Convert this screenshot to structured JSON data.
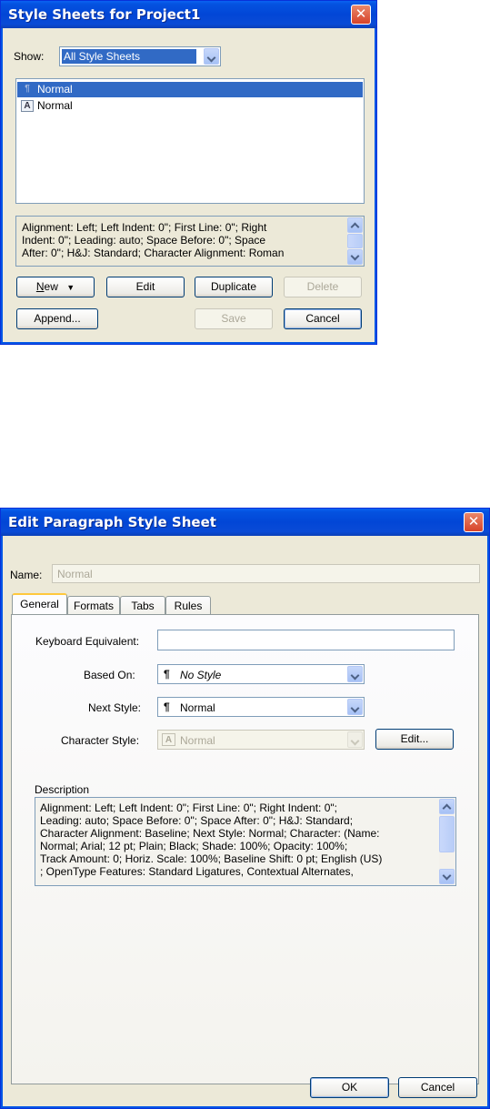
{
  "dialog1": {
    "title": "Style Sheets for Project1",
    "close_glyph": "✕",
    "show_label": "Show:",
    "show_value": "All Style Sheets",
    "list_items": [
      {
        "label": "Normal",
        "icon": "paragraph-style-icon",
        "icon_glyph": "¶",
        "selected": true
      },
      {
        "label": "Normal",
        "icon": "character-style-icon",
        "icon_glyph": "A",
        "selected": false
      }
    ],
    "description_lines": [
      "Alignment: Left;  Left Indent: 0\";  First Line: 0\";  Right",
      "Indent: 0\";  Leading: auto;  Space Before: 0\";  Space",
      "After: 0\";  H&J: Standard;  Character Alignment: Roman"
    ],
    "buttons": {
      "new_prefix": "N",
      "new_rest": "ew",
      "new_arrow": "▼",
      "edit": "Edit",
      "duplicate": "Duplicate",
      "delete": "Delete",
      "append": "Append...",
      "save": "Save",
      "cancel": "Cancel"
    },
    "colors": {
      "selection": "#316ac5",
      "title_bar": "#0246d6"
    }
  },
  "dialog2": {
    "title": "Edit Paragraph Style Sheet",
    "close_glyph": "✕",
    "name_label": "Name:",
    "name_value": "Normal",
    "tabs": [
      {
        "label": "General",
        "active": true
      },
      {
        "label": "Formats",
        "active": false
      },
      {
        "label": "Tabs",
        "active": false
      },
      {
        "label": "Rules",
        "active": false
      }
    ],
    "keyboard_equivalent_label": "Keyboard Equivalent:",
    "keyboard_equivalent_value": "",
    "based_on_label": "Based On:",
    "based_on_value": "No Style",
    "based_on_glyph": "¶",
    "next_style_label": "Next Style:",
    "next_style_value": "Normal",
    "next_style_glyph": "¶",
    "character_style_label": "Character Style:",
    "character_style_value": "Normal",
    "character_style_glyph": "A",
    "edit_button": "Edit...",
    "description_label": "Description",
    "description_lines": [
      "Alignment: Left;  Left Indent: 0\";  First Line: 0\";  Right Indent: 0\";",
      "Leading: auto;  Space Before: 0\";  Space After: 0\";  H&J: Standard;",
      "Character Alignment: Baseline;  Next Style: Normal;  Character: (Name:",
      "Normal;  Arial;  12 pt;  Plain;  Black;  Shade: 100%;  Opacity: 100%;",
      "Track Amount: 0;  Horiz. Scale: 100%;  Baseline Shift: 0 pt;  English (US)",
      ";  OpenType Features: Standard Ligatures, Contextual Alternates,"
    ],
    "ok_button": "OK",
    "cancel_button": "Cancel"
  }
}
